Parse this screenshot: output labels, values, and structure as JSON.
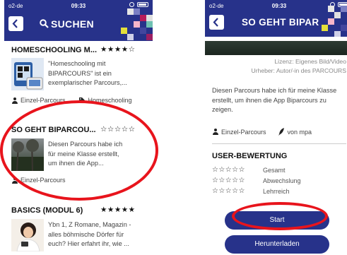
{
  "status": {
    "carrier": "o2-de",
    "time": "09:33"
  },
  "left": {
    "header_title": "SUCHEN",
    "entries": [
      {
        "title": "HOMESCHOOLING M...",
        "stars": "★★★★☆",
        "description": [
          "\"Homeschooling mit",
          "BIPARCOURS\" ist ein",
          "exemplarischer Parcours,..."
        ],
        "meta": [
          "Einzel-Parcours",
          "Homeschooling"
        ]
      },
      {
        "title": "SO GEHT BIPARCOU...",
        "stars": "☆☆☆☆☆",
        "description": [
          "Diesen Parcours habe ich",
          "für meine Klasse erstellt,",
          "um ihnen die App..."
        ],
        "meta": [
          "Einzel-Parcours"
        ]
      },
      {
        "title": "BASICS (MODUL 6)",
        "stars": "★★★★★",
        "description": [
          "Ybn 1, Z Romane, Magazin -",
          "alles böhmische Dörfer für",
          "euch? Hier erfahrt ihr, wie ..."
        ]
      }
    ]
  },
  "right": {
    "header_title": "SO GEHT BIPAR",
    "credit": [
      "Lizenz: Eigenes Bild/Video",
      "Urheber: Autor/-in des PARCOURS"
    ],
    "description": [
      "Diesen Parcours habe ich für meine Klasse",
      "erstellt, um ihnen die App Biparcours zu",
      "zeigen."
    ],
    "meta_type": "Einzel-Parcours",
    "meta_author": "von mpa",
    "rating_heading": "USER-BEWERTUNG",
    "ratings": [
      {
        "stars": "☆☆☆☆☆",
        "label": "Gesamt"
      },
      {
        "stars": "☆☆☆☆☆",
        "label": "Abwechslung"
      },
      {
        "stars": "☆☆☆☆☆",
        "label": "Lehrreich"
      }
    ],
    "start_label": "Start",
    "download_label": "Herunterladen"
  },
  "colors": {
    "header_blue": "#27328a",
    "highlight_red": "#e8141c"
  }
}
